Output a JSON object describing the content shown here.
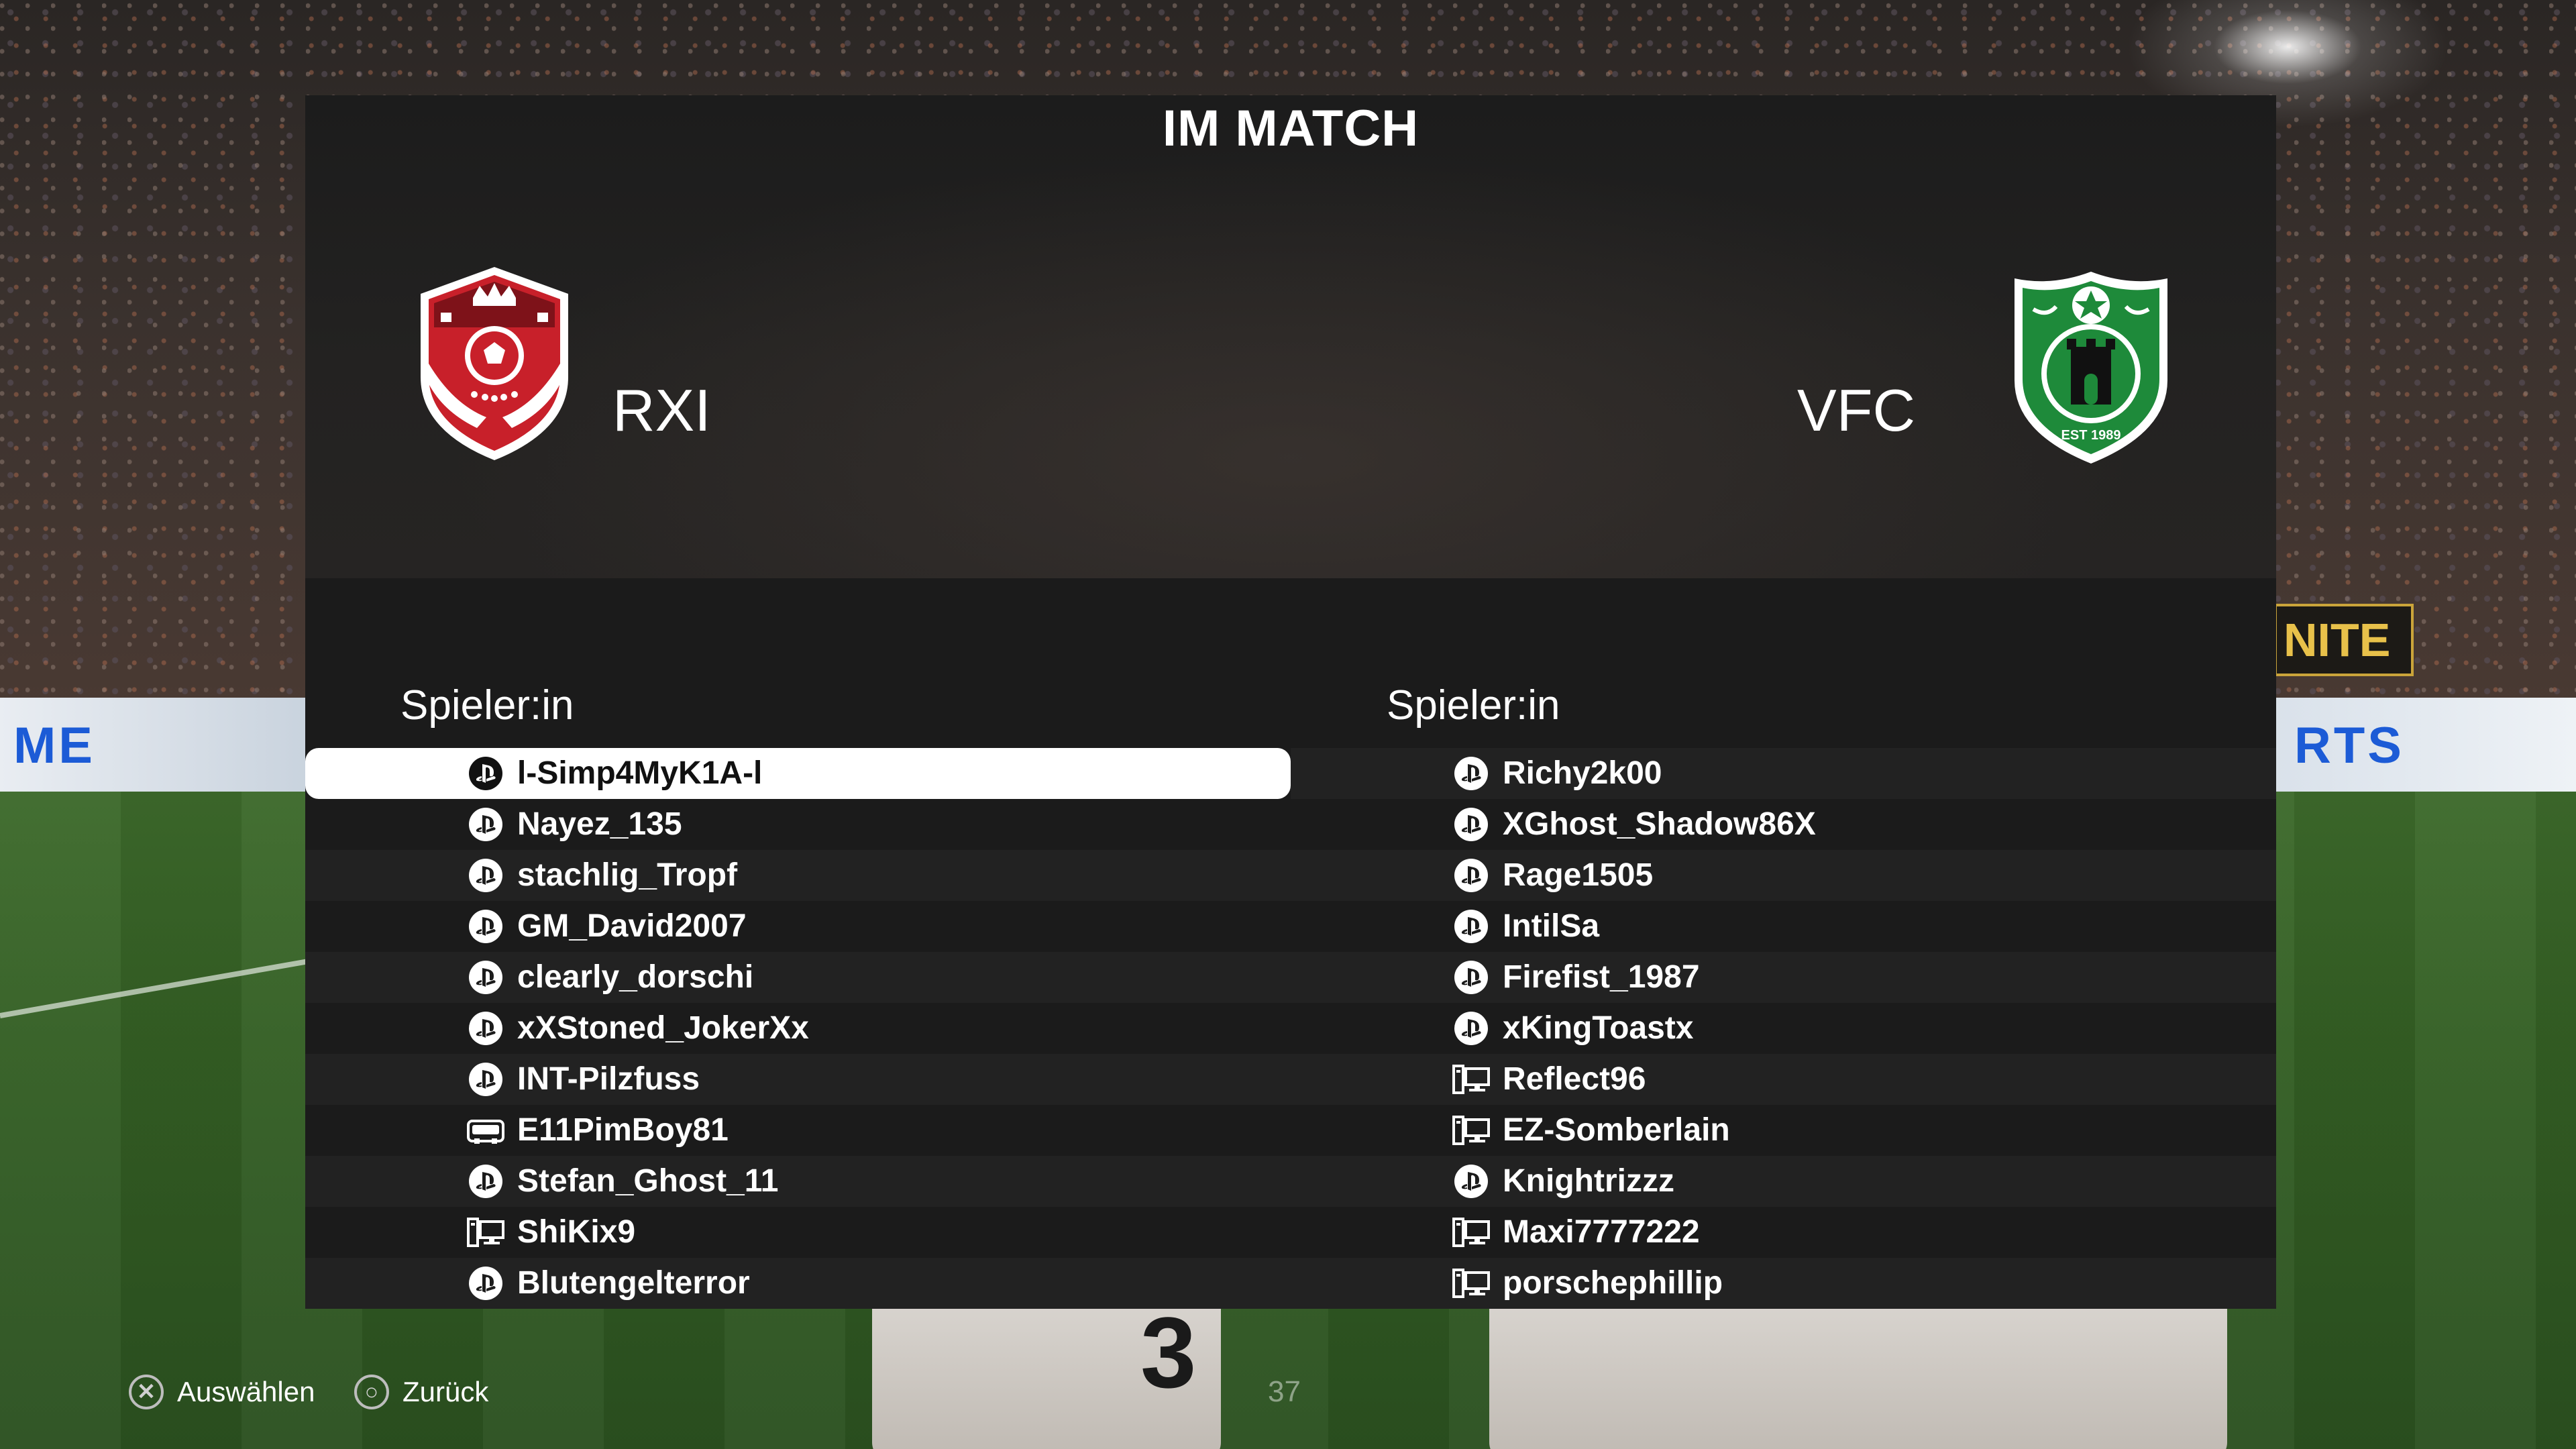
{
  "screen": {
    "title": "IM MATCH",
    "page_number": "37"
  },
  "home_team": {
    "name": "RXI",
    "crest_icon": "rxi-crest-icon",
    "players_header": "Spieler:in",
    "players": [
      {
        "name": "l-Simp4MyK1A-l",
        "platform": "playstation",
        "selected": true
      },
      {
        "name": "Nayez_135",
        "platform": "playstation"
      },
      {
        "name": "stachlig_Tropf",
        "platform": "playstation"
      },
      {
        "name": "GM_David2007",
        "platform": "playstation"
      },
      {
        "name": "clearly_dorschi",
        "platform": "playstation"
      },
      {
        "name": "xXStoned_JokerXx",
        "platform": "playstation"
      },
      {
        "name": "INT-Pilzfuss",
        "platform": "playstation"
      },
      {
        "name": "E11PimBoy81",
        "platform": "xbox"
      },
      {
        "name": "Stefan_Ghost_11",
        "platform": "playstation"
      },
      {
        "name": "ShiKix9",
        "platform": "pc"
      },
      {
        "name": "Blutengelterror",
        "platform": "playstation"
      }
    ]
  },
  "away_team": {
    "name": "VFC",
    "crest_icon": "vfc-crest-icon",
    "crest_text": "EST 1989",
    "players_header": "Spieler:in",
    "players": [
      {
        "name": "Richy2k00",
        "platform": "playstation"
      },
      {
        "name": "XGhost_Shadow86X",
        "platform": "playstation"
      },
      {
        "name": "Rage1505",
        "platform": "playstation"
      },
      {
        "name": "IntilSa",
        "platform": "playstation"
      },
      {
        "name": "Firefist_1987",
        "platform": "playstation"
      },
      {
        "name": "xKingToastx",
        "platform": "playstation"
      },
      {
        "name": "Reflect96",
        "platform": "pc"
      },
      {
        "name": "EZ-Somberlain",
        "platform": "pc"
      },
      {
        "name": "Knightrizzz",
        "platform": "playstation"
      },
      {
        "name": "Maxi7777222",
        "platform": "pc"
      },
      {
        "name": "porschephillip",
        "platform": "pc"
      }
    ]
  },
  "controls": {
    "select": {
      "button_icon": "cross-button-icon",
      "label": "Auswählen"
    },
    "back": {
      "button_icon": "circle-button-icon",
      "label": "Zurück"
    }
  },
  "colors": {
    "panel": "#1b1b1b",
    "row_alt": "#222222",
    "selected_row": "#ffffff",
    "rxi_red": "#c8202a",
    "vfc_green": "#1e8a3a"
  }
}
